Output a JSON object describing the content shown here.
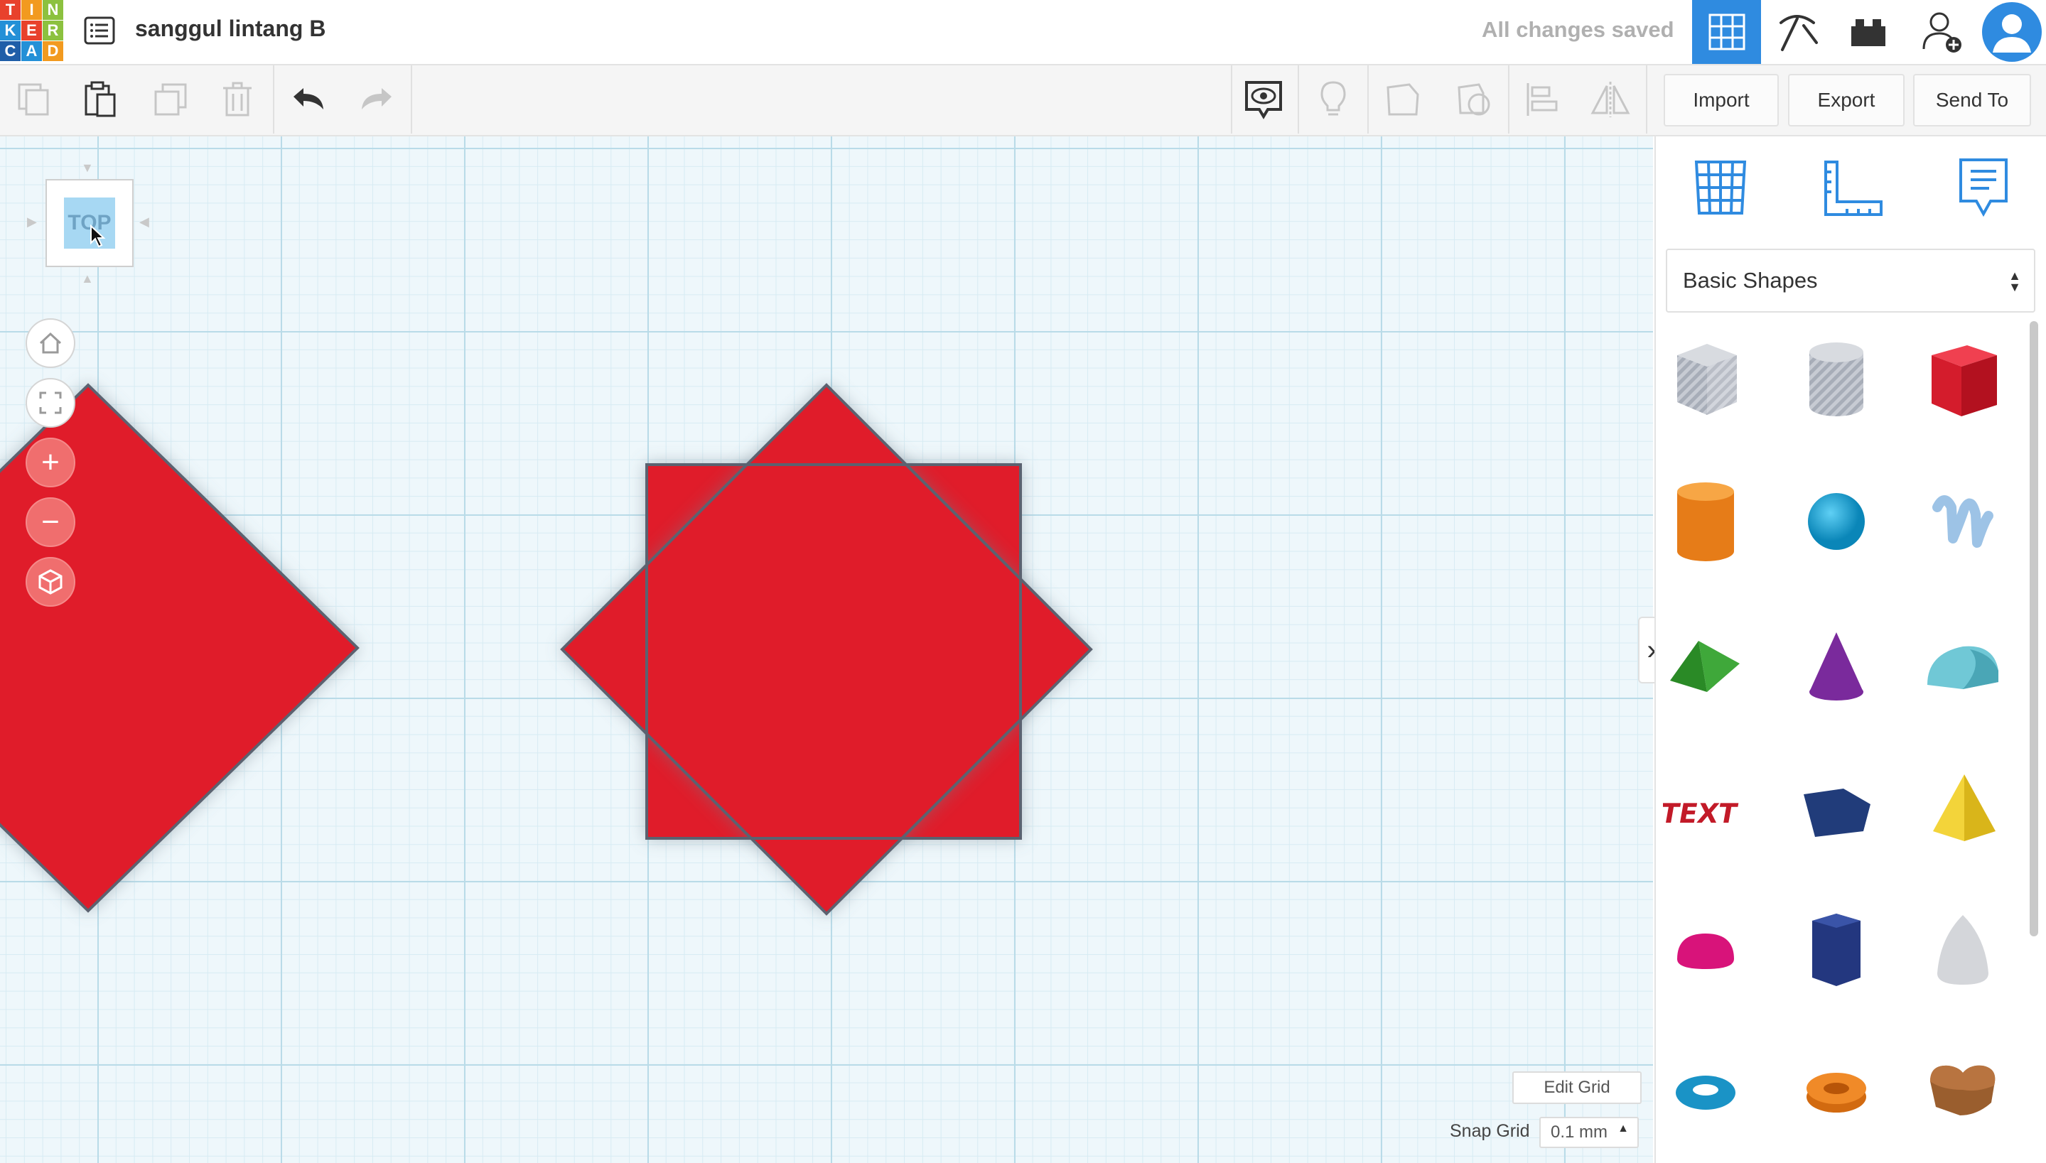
{
  "app": {
    "logo_letters": [
      "T",
      "I",
      "N",
      "K",
      "E",
      "R",
      "C",
      "A",
      "D"
    ],
    "design_title": "sanggul lintang B",
    "save_status": "All changes saved"
  },
  "topbar_icons": [
    "grid-view-icon",
    "pickaxe-icon",
    "brick-icon",
    "add-user-icon",
    "user-avatar-icon"
  ],
  "toolbar": {
    "import_label": "Import",
    "export_label": "Export",
    "send_to_label": "Send To"
  },
  "viewcube": {
    "face_label": "TOP"
  },
  "nav_controls": {
    "zoom_in": "+",
    "zoom_out": "−"
  },
  "workplane": {
    "edit_grid_label": "Edit Grid",
    "snap_grid_label": "Snap Grid",
    "snap_grid_value": "0.1 mm"
  },
  "panel": {
    "category_selected": "Basic Shapes",
    "shapes": [
      "Box (hole)",
      "Cylinder (hole)",
      "Box",
      "Cylinder",
      "Sphere",
      "Scribble",
      "Roof",
      "Cone",
      "Round Roof",
      "Text",
      "Polygon",
      "Pyramid",
      "Half Sphere",
      "Hexagonal Prism",
      "Paraboloid",
      "Torus",
      "Tube",
      "Heart"
    ]
  },
  "colors": {
    "shape_red": "#e01a2b",
    "accent_blue": "#2f8be0",
    "workplane_bg": "#eef7fb"
  }
}
